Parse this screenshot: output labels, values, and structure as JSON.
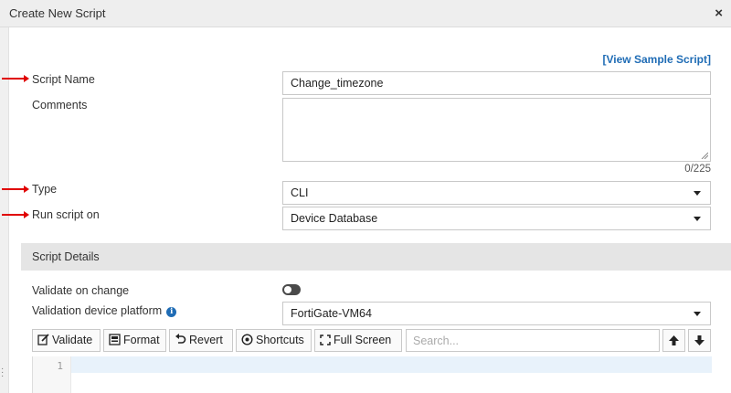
{
  "dialog": {
    "title": "Create New Script",
    "close_glyph": "×"
  },
  "sample_link": "[View Sample Script]",
  "form": {
    "script_name_label": "Script Name",
    "script_name_value": "Change_timezone",
    "comments_label": "Comments",
    "comments_counter": "0/225",
    "type_label": "Type",
    "type_value": "CLI",
    "run_on_label": "Run script on",
    "run_on_value": "Device Database"
  },
  "details": {
    "section_title": "Script Details",
    "validate_on_change_label": "Validate on change",
    "validation_platform_label": "Validation device platform",
    "validation_platform_value": "FortiGate-VM64"
  },
  "toolbar": {
    "validate": "Validate",
    "format": "Format",
    "revert": "Revert",
    "shortcuts": "Shortcuts",
    "fullscreen": "Full Screen",
    "search_placeholder": "Search..."
  },
  "editor": {
    "first_line_number": "1"
  },
  "colors": {
    "link": "#1f6cb5",
    "arrow": "#e00000",
    "section_bg": "#e5e5e5"
  }
}
